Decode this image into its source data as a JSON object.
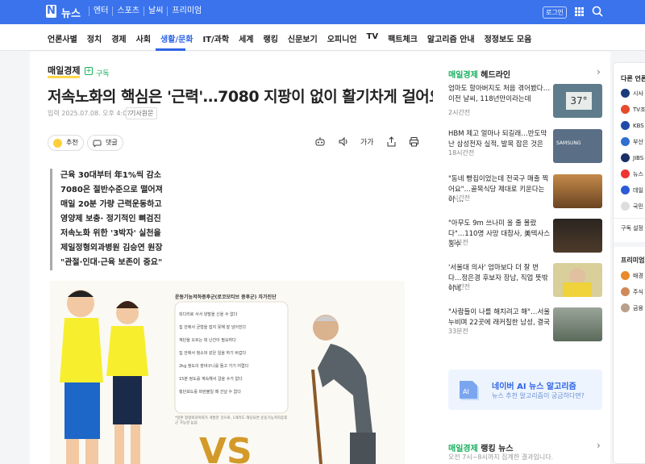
{
  "gnb": {
    "logo": "N",
    "brand": "뉴스",
    "links": [
      "엔터",
      "스포츠",
      "날씨",
      "프리미엄"
    ],
    "login": "로그인"
  },
  "sections": [
    "언론사별",
    "정치",
    "경제",
    "사회",
    "생활/문화",
    "IT/과학",
    "세계",
    "랭킹",
    "신문보기",
    "오피니언",
    "TV",
    "팩트체크",
    "알고리즘 안내",
    "정정보도 모음"
  ],
  "article": {
    "press": "매일경제",
    "subscribe": "구독",
    "title": "저속노화의 핵심은 '근력'…7080 지팡이 없이 활기차게 걸어요",
    "date": "입력 2025.07.08. 오후 4:07",
    "original": "기사원문",
    "recommend": "추천",
    "comment": "댓글",
    "font_label": "가가",
    "lede": [
      "근육 30대부터 年1%씩 감소",
      "7080은 절반수준으로 떨어져",
      "매일 20분 가량 근력운동하고",
      "영양제 보충· 정기적인 뼈검진",
      "저속노화 위한 '3박자' 실천을",
      "제일정형외과병원 김승연 원장",
      "\"관절·인대·근육 보존이 중요\""
    ],
    "image": {
      "checklist_title": "운동기능저하증후군(로코모티브 증후군) 자가진단",
      "checklist": [
        "외다리로 서서 양말을 신을 수 없다",
        "집 안에서 균형을 잡지 못해 잘 넘어진다",
        "계단을 오르는 데 난간이 필요하다",
        "집 안에서 청소와 같은 일을 하기 버겁다",
        "2kg 정도의 장바구니를 들고 가기 어렵다",
        "15분 정도를 계속해서 걸을 수가 없다",
        "횡단보도를 파란불일 때 건널 수 없다"
      ],
      "note": "*일본 정형외과학회가 개발한 것으로, 1개라도 해당되면 운동기능저하증후군 가능성 높음.",
      "vs": "VS"
    }
  },
  "sidebar": {
    "header_press": "매일경제",
    "header": "헤드라인",
    "items": [
      {
        "title": "엄마도 할아버지도 처음 겪어봤다…이전 날씨, 118년만이라는데",
        "meta": "2시간전",
        "thumb": "37°"
      },
      {
        "title": "HBM 제고 얼마나 되길래…반도막 난 삼성전자 실적, 발목 잡은 것은",
        "meta": "18시간전",
        "thumb": "SAMSUNG"
      },
      {
        "title": "\"동네 빵집이었는데 전국구 매출 찍어요\"…골목식당 제대로 키운다는 이 …",
        "meta": "2시간전",
        "thumb": ""
      },
      {
        "title": "\"아무도 9m 쓰나미 올 줄 몰랐다\"…110명 사망 대참사, 美텍사스 홍수",
        "meta": "57분전",
        "thumb": ""
      },
      {
        "title": "'서울대 의사' 엄마보다 더 잘 번다…정은경 후보자 장남, 직업 뜻밖이네",
        "meta": "1시간전",
        "thumb": ""
      },
      {
        "title": "\"사람들이 나를 해치려고 해\"…서울 누비며 22곳에 래커칠한 남성, 결국",
        "meta": "33분전",
        "thumb": ""
      }
    ],
    "ai_title": "네이버 AI 뉴스 알고리즘",
    "ai_desc": "뉴스 추천 알고리즘이 궁금하다면?",
    "rank_press": "매일경제",
    "rank_title": "랭킹 뉴스",
    "rank_desc": "오전 7시~8시까지 집계한 결과입니다."
  },
  "rightbar": {
    "header": "다른 언론사",
    "items": [
      "시사",
      "TV조",
      "KBS",
      "부산",
      "JIBS",
      "뉴스",
      "데일",
      "국민"
    ],
    "sub": "구독 설정",
    "premium": "프리미엄",
    "premium_items": [
      "매경",
      "주식",
      "금융"
    ]
  },
  "colors": {
    "naver_blue": "#3a73ec",
    "green": "#19b15f"
  }
}
